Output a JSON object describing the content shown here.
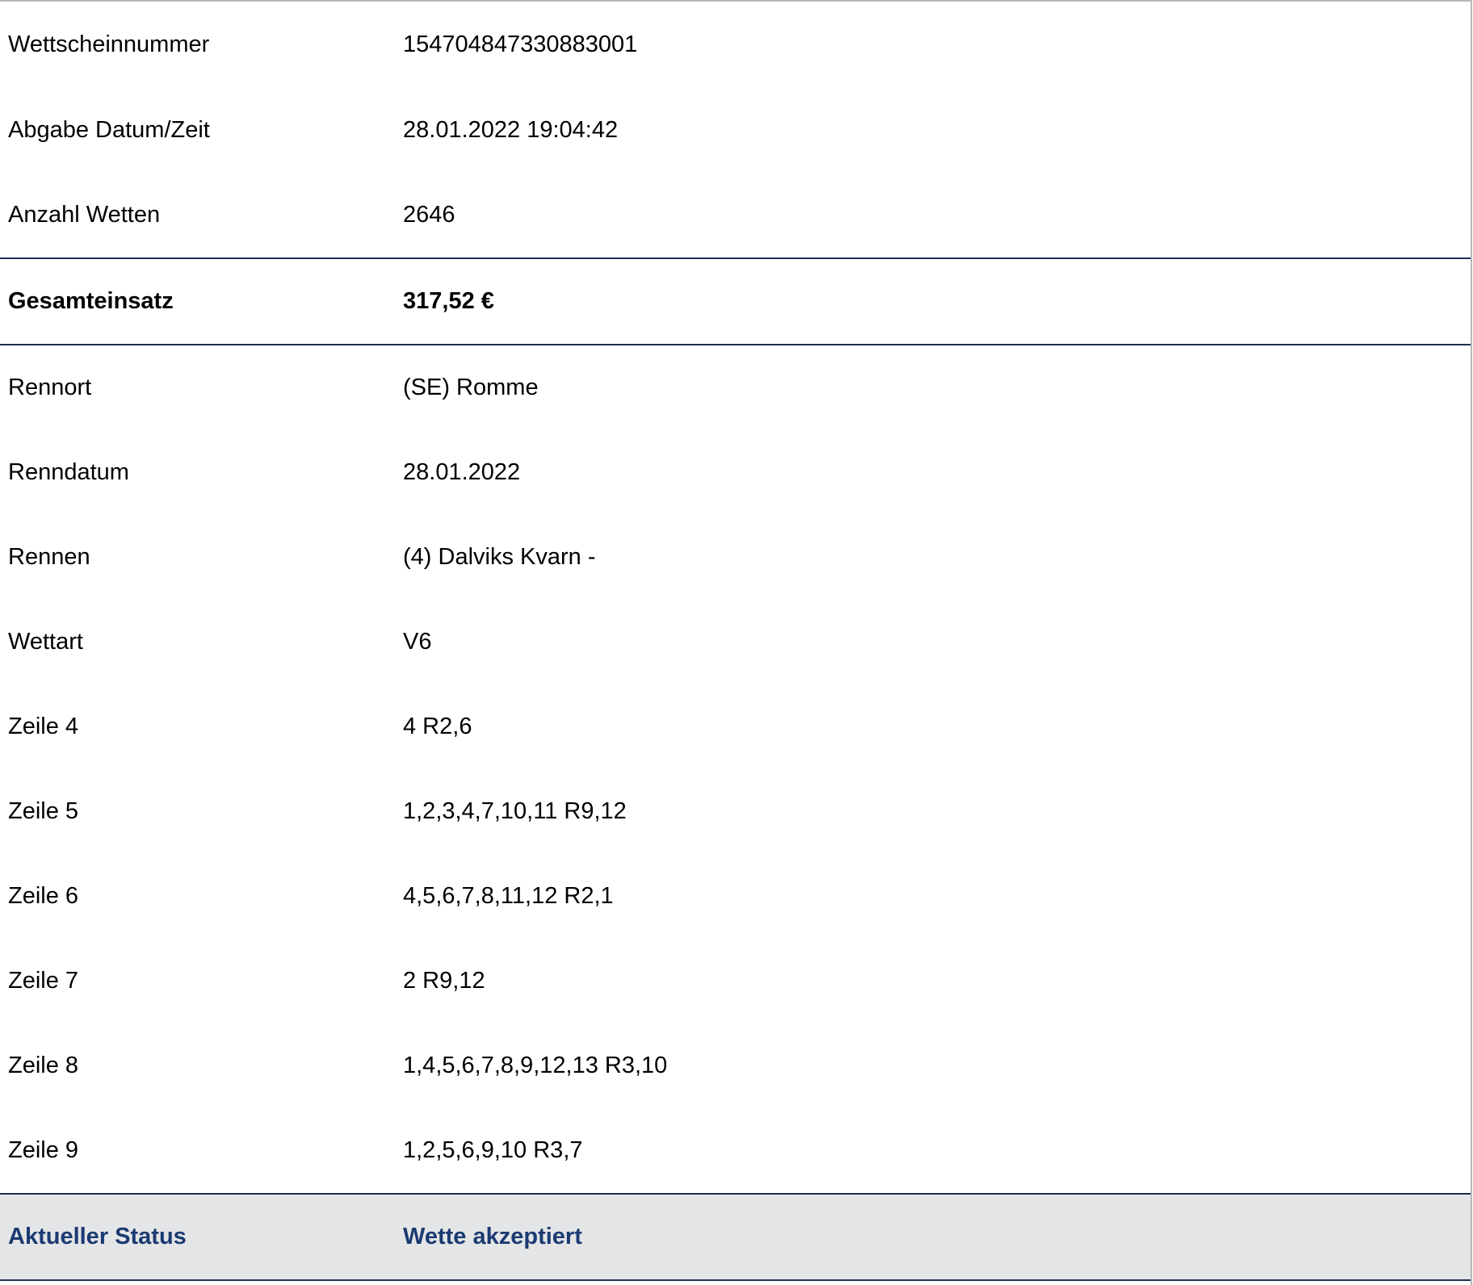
{
  "ticket": {
    "rows": [
      {
        "label": "Wettscheinnummer",
        "value": "154704847330883001"
      },
      {
        "label": "Abgabe Datum/Zeit",
        "value": "28.01.2022 19:04:42"
      },
      {
        "label": "Anzahl Wetten",
        "value": "2646"
      }
    ],
    "total": {
      "label": "Gesamteinsatz",
      "value": "317,52 €"
    },
    "details": [
      {
        "label": "Rennort",
        "value": "(SE) Romme"
      },
      {
        "label": "Renndatum",
        "value": "28.01.2022"
      },
      {
        "label": "Rennen",
        "value": "(4) Dalviks Kvarn -"
      },
      {
        "label": "Wettart",
        "value": "V6"
      },
      {
        "label": "Zeile 4",
        "value": "4 R2,6"
      },
      {
        "label": "Zeile 5",
        "value": "1,2,3,4,7,10,11 R9,12"
      },
      {
        "label": "Zeile 6",
        "value": "4,5,6,7,8,11,12 R2,1"
      },
      {
        "label": "Zeile 7",
        "value": "2 R9,12"
      },
      {
        "label": "Zeile 8",
        "value": "1,4,5,6,7,8,9,12,13 R3,10"
      },
      {
        "label": "Zeile 9",
        "value": "1,2,5,6,9,10 R3,7"
      }
    ],
    "status": {
      "label": "Aktueller Status",
      "value": "Wette akzeptiert"
    }
  },
  "colors": {
    "status_text": "#1b3a72",
    "status_background": "#e4e5e6",
    "divider": "#1d2f52"
  }
}
